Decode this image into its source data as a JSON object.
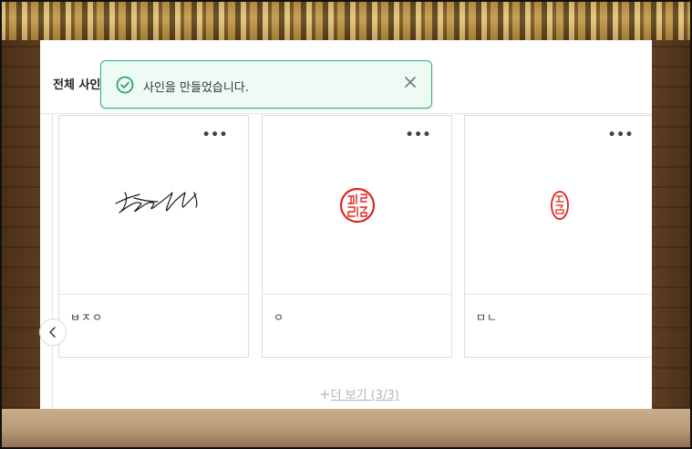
{
  "page": {
    "tab_title": "전체 사인"
  },
  "toast": {
    "message": "사인을 만들었습니다.",
    "icon": "check-circle-icon",
    "close_icon": "close-icon",
    "accent_color": "#34b27a"
  },
  "cards": [
    {
      "caption": "ㅂㅈㅇ",
      "type": "handwritten-signature",
      "more_label": "•••"
    },
    {
      "caption": "ㅇ",
      "type": "round-seal-stamp",
      "stamp_text": "레리멸킹",
      "more_label": "•••"
    },
    {
      "caption": "ㅁㄴ",
      "type": "oval-seal-stamp",
      "stamp_text": "체결방",
      "more_label": "•••"
    }
  ],
  "stamp_color": "#e0231b",
  "pagination": {
    "prev_icon": "chevron-left-icon"
  },
  "load_more": {
    "plus": "+",
    "label": "더 보기 (3/3)"
  }
}
